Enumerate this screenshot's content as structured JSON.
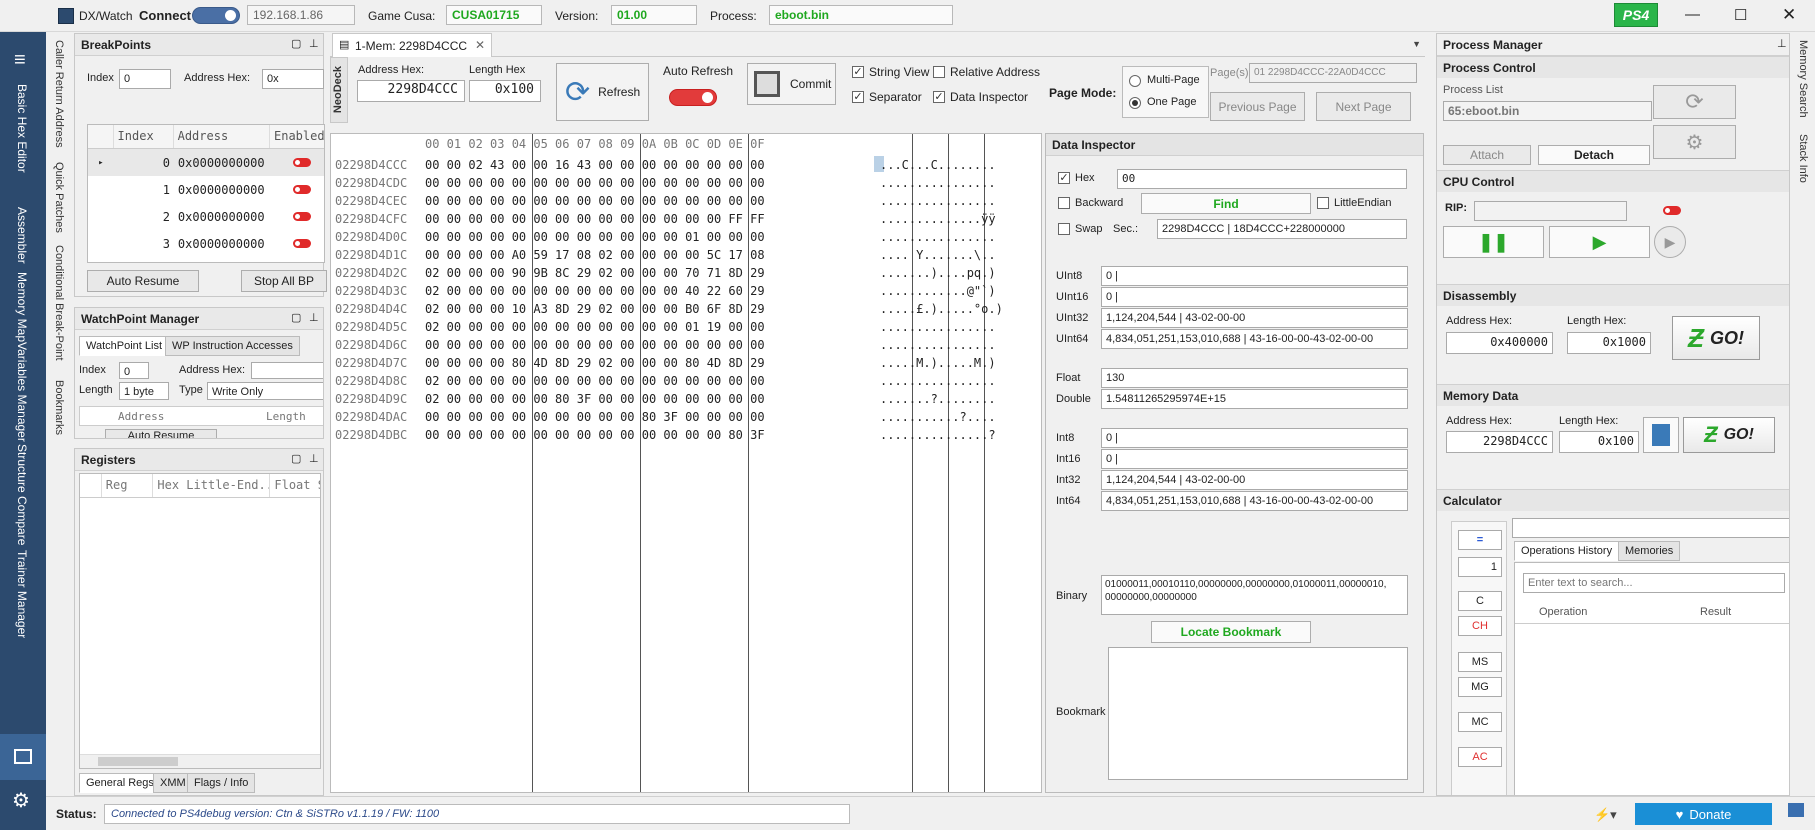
{
  "app": {
    "title": "DX/Watch",
    "connect_label": "Connect",
    "ip": "192.168.1.86",
    "game_cusa_label": "Game Cusa:",
    "game_cusa": "CUSA01715",
    "version_label": "Version:",
    "version": "01.00",
    "process_label": "Process:",
    "process": "eboot.bin",
    "badge": "PS4"
  },
  "leftbar": {
    "items": [
      "Basic Hex Editor",
      "Assembler",
      "Memory Map",
      "Variables Manager",
      "Structure Compare",
      "Trainer Manager"
    ]
  },
  "side_tabs": {
    "left": [
      "Caller Return Address",
      "Quick Patches",
      "Conditional Break-Point",
      "Bookmarks"
    ],
    "right": [
      "Memory Search",
      "Stack Info"
    ]
  },
  "breakpoints": {
    "title": "BreakPoints",
    "index_label": "Index",
    "index_value": "0",
    "address_label": "Address Hex:",
    "address_value": "0x",
    "columns": [
      "Index",
      "Address",
      "Enabled"
    ],
    "rows": [
      {
        "index": "0",
        "address": "0x0000000000"
      },
      {
        "index": "1",
        "address": "0x0000000000"
      },
      {
        "index": "2",
        "address": "0x0000000000"
      },
      {
        "index": "3",
        "address": "0x0000000000"
      }
    ],
    "auto_resume": "Auto Resume",
    "stop_all": "Stop All BP"
  },
  "watchpoint": {
    "title": "WatchPoint Manager",
    "tabs": [
      "WatchPoint List",
      "WP Instruction Accesses"
    ],
    "index_label": "Index",
    "index_value": "0",
    "address_label": "Address Hex:",
    "length_label": "Length",
    "length_value": "1 byte",
    "type_label": "Type",
    "type_value": "Write Only",
    "columns": [
      "Address",
      "Length"
    ],
    "auto_resume": "Auto Resume"
  },
  "registers": {
    "title": "Registers",
    "columns": [
      "Reg",
      "Hex Little-End...",
      "Float S"
    ],
    "tabs": [
      "General Regs",
      "XMM",
      "Flags / Info"
    ]
  },
  "mem": {
    "tab_title": "1-Mem: 2298D4CCC",
    "neodeck": "NeoDeck",
    "address_label": "Address Hex:",
    "address_value": "2298D4CCC",
    "length_label": "Length Hex",
    "length_value": "0x100",
    "refresh": "Refresh",
    "auto_refresh": "Auto Refresh",
    "commit": "Commit",
    "string_view": "String View",
    "relative_address": "Relative Address",
    "separator": "Separator",
    "data_inspector": "Data Inspector",
    "page_mode_label": "Page Mode:",
    "multi_page": "Multi-Page",
    "one_page": "One Page",
    "pages_label": "Page(s)",
    "pages_value": "01 2298D4CCC-22A0D4CCC",
    "prev_page": "Previous Page",
    "next_page": "Next Page"
  },
  "hex": {
    "header": "00 01 02 03 04 05 06 07 08 09 0A 0B 0C 0D 0E 0F",
    "rows": [
      {
        "addr": "02298D4CCC",
        "bytes": "00 00 02 43 00 00 16 43 00 00 00 00 00 00 00 00",
        "ascii": "...C...C........"
      },
      {
        "addr": "02298D4CDC",
        "bytes": "00 00 00 00 00 00 00 00 00 00 00 00 00 00 00 00",
        "ascii": "................"
      },
      {
        "addr": "02298D4CEC",
        "bytes": "00 00 00 00 00 00 00 00 00 00 00 00 00 00 00 00",
        "ascii": "................"
      },
      {
        "addr": "02298D4CFC",
        "bytes": "00 00 00 00 00 00 00 00 00 00 00 00 00 00 FF FF",
        "ascii": "..............ÿÿ"
      },
      {
        "addr": "02298D4D0C",
        "bytes": "00 00 00 00 00 00 00 00 00 00 00 00 01 00 00 00",
        "ascii": "................"
      },
      {
        "addr": "02298D4D1C",
        "bytes": "00 00 00 00 A0 59 17 08 02 00 00 00 00 5C 17 08",
        "ascii": ".... Y.......\\.."
      },
      {
        "addr": "02298D4D2C",
        "bytes": "02 00 00 00 90 9B 8C 29 02 00 00 00 70 71 8D 29",
        "ascii": ".......)....pq.)"
      },
      {
        "addr": "02298D4D3C",
        "bytes": "02 00 00 00 00 00 00 00 00 00 00 00 40 22 60 29",
        "ascii": "............@\"`)"
      },
      {
        "addr": "02298D4D4C",
        "bytes": "02 00 00 00 10 A3 8D 29 02 00 00 00 B0 6F 8D 29",
        "ascii": ".....£.).....°o.)"
      },
      {
        "addr": "02298D4D5C",
        "bytes": "02 00 00 00 00 00 00 00 00 00 00 00 01 19 00 00",
        "ascii": "................"
      },
      {
        "addr": "02298D4D6C",
        "bytes": "00 00 00 00 00 00 00 00 00 00 00 00 00 00 00 00",
        "ascii": "................"
      },
      {
        "addr": "02298D4D7C",
        "bytes": "00 00 00 00 80 4D 8D 29 02 00 00 00 80 4D 8D 29",
        "ascii": ".....M.).....M.)"
      },
      {
        "addr": "02298D4D8C",
        "bytes": "02 00 00 00 00 00 00 00 00 00 00 00 00 00 00 00",
        "ascii": "................"
      },
      {
        "addr": "02298D4D9C",
        "bytes": "02 00 00 00 00 00 80 3F 00 00 00 00 00 00 00 00",
        "ascii": ".......?........"
      },
      {
        "addr": "02298D4DAC",
        "bytes": "00 00 00 00 00 00 00 00 00 00 80 3F 00 00 00 00",
        "ascii": "...........?...."
      },
      {
        "addr": "02298D4DBC",
        "bytes": "00 00 00 00 00 00 00 00 00 00 00 00 00 00 80 3F",
        "ascii": "...............?"
      }
    ]
  },
  "inspector": {
    "title": "Data Inspector",
    "hex_label": "Hex",
    "hex_value": "00",
    "backward": "Backward",
    "find": "Find",
    "little_endian": "LittleEndian",
    "swap": "Swap",
    "sec_label": "Sec.:",
    "sec_value": "2298D4CCC | 18D4CCC+228000000",
    "fields": [
      {
        "label": "UInt8",
        "value": "0 |"
      },
      {
        "label": "UInt16",
        "value": "0 |"
      },
      {
        "label": "UInt32",
        "value": "1,124,204,544 | 43-02-00-00"
      },
      {
        "label": "UInt64",
        "value": "4,834,051,251,153,010,688 | 43-16-00-00-43-02-00-00"
      },
      {
        "label": "Float",
        "value": "130"
      },
      {
        "label": "Double",
        "value": "1.54811265295974E+15"
      },
      {
        "label": "Int8",
        "value": "0 |"
      },
      {
        "label": "Int16",
        "value": "0 |"
      },
      {
        "label": "Int32",
        "value": "1,124,204,544 | 43-02-00-00"
      },
      {
        "label": "Int64",
        "value": "4,834,051,251,153,010,688 | 43-16-00-00-43-02-00-00"
      }
    ],
    "binary_label": "Binary",
    "binary_value": "01000011,00010110,00000000,00000000,01000011,00000010,00000000,00000000",
    "locate_bookmark": "Locate Bookmark",
    "bookmark_label": "Bookmark"
  },
  "process_manager": {
    "title": "Process Manager",
    "control_title": "Process Control",
    "list_label": "Process List",
    "process_value": "65:eboot.bin",
    "attach": "Attach",
    "detach": "Detach",
    "cpu_title": "CPU Control",
    "rip_label": "RIP:",
    "disasm_title": "Disassembly",
    "disasm_addr_label": "Address Hex:",
    "disasm_addr": "0x400000",
    "disasm_len_label": "Length Hex:",
    "disasm_len": "0x1000",
    "go": "GO!",
    "memdata_title": "Memory Data",
    "mem_addr_label": "Address Hex:",
    "mem_addr": "2298D4CCC",
    "mem_len_label": "Length Hex:",
    "mem_len": "0x100",
    "calc_title": "Calculator",
    "calc_buttons": [
      "=",
      "C",
      "CH",
      "MS",
      "MG",
      "MC",
      "AC"
    ],
    "calc_num": "1",
    "calc_tabs": [
      "Operations History",
      "Memories"
    ],
    "search_placeholder": "Enter text to search...",
    "calc_columns": [
      "Operation",
      "Result"
    ]
  },
  "status": {
    "label": "Status:",
    "text": "Connected to PS4debug version: Ctn & SiSTRo v1.1.19  /  FW: 1100",
    "donate": "Donate"
  },
  "colors": {
    "accent": "#2c4a6e",
    "green": "#1fa81f",
    "red": "#e02a2a"
  }
}
